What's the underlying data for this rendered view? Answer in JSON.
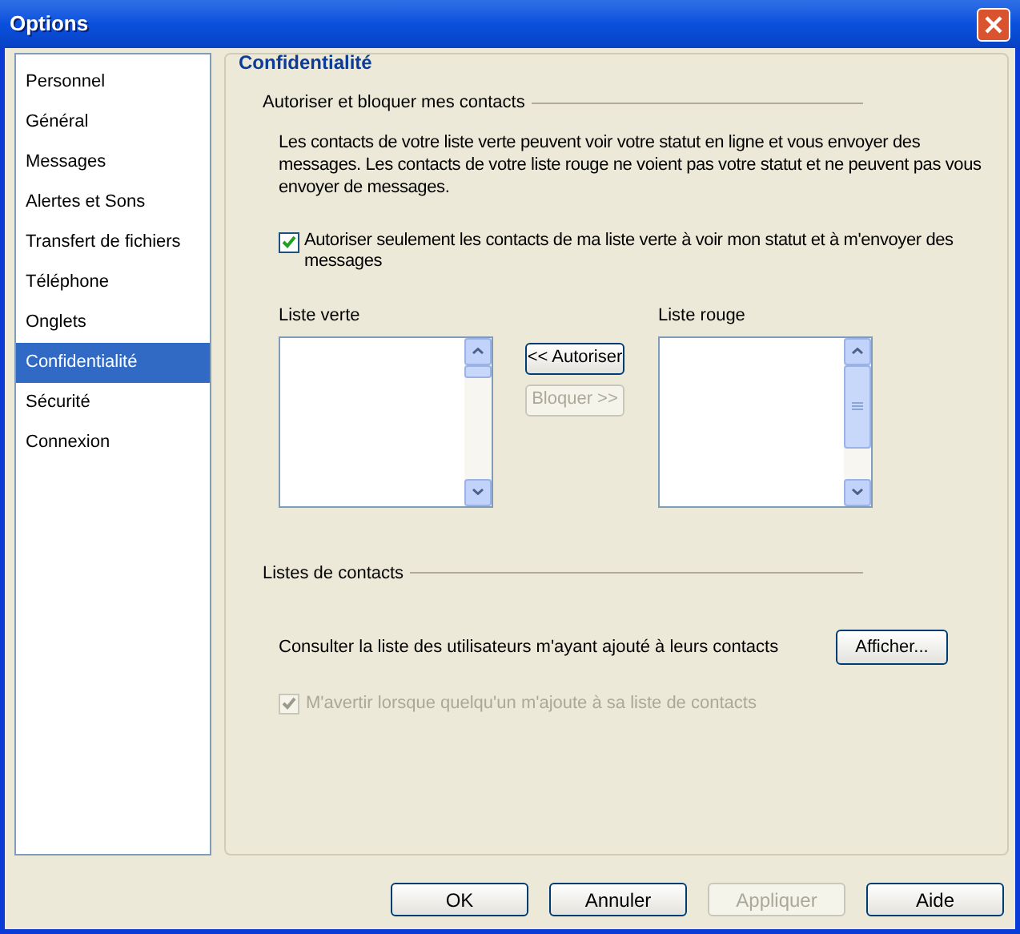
{
  "window": {
    "title": "Options"
  },
  "sidebar": {
    "items": [
      {
        "label": "Personnel",
        "selected": false
      },
      {
        "label": "Général",
        "selected": false
      },
      {
        "label": "Messages",
        "selected": false
      },
      {
        "label": "Alertes et Sons",
        "selected": false
      },
      {
        "label": "Transfert de fichiers",
        "selected": false
      },
      {
        "label": "Téléphone",
        "selected": false
      },
      {
        "label": "Onglets",
        "selected": false
      },
      {
        "label": "Confidentialité",
        "selected": true
      },
      {
        "label": "Sécurité",
        "selected": false
      },
      {
        "label": "Connexion",
        "selected": false
      }
    ]
  },
  "panel": {
    "title": "Confidentialité",
    "block_section": {
      "title": "Autoriser et bloquer mes contacts",
      "description": "Les contacts de votre liste verte peuvent voir votre statut en ligne et vous envoyer des messages. Les contacts de votre liste rouge ne voient pas votre statut et ne peuvent pas vous envoyer de messages.",
      "checkbox": {
        "label": "Autoriser seulement les contacts de ma liste verte à voir mon statut et à m'envoyer des messages",
        "checked": true
      },
      "green_list": {
        "label": "Liste verte"
      },
      "red_list": {
        "label": "Liste rouge"
      },
      "buttons": [
        {
          "label": "<< Autoriser",
          "disabled": false
        },
        {
          "label": "Bloquer >>",
          "disabled": true
        }
      ]
    },
    "contacts_section": {
      "title": "Listes de contacts",
      "row_text": "Consulter la liste des utilisateurs m'ayant ajouté à leurs contacts",
      "button": {
        "label": "Afficher..."
      },
      "checkbox": {
        "label": "M'avertir lorsque quelqu'un m'ajoute à sa liste de contacts",
        "checked": true,
        "disabled": true
      }
    }
  },
  "footer": {
    "buttons": [
      {
        "label": "OK",
        "disabled": false
      },
      {
        "label": "Annuler",
        "disabled": false
      },
      {
        "label": "Appliquer",
        "disabled": true
      },
      {
        "label": "Aide",
        "disabled": false
      }
    ]
  }
}
